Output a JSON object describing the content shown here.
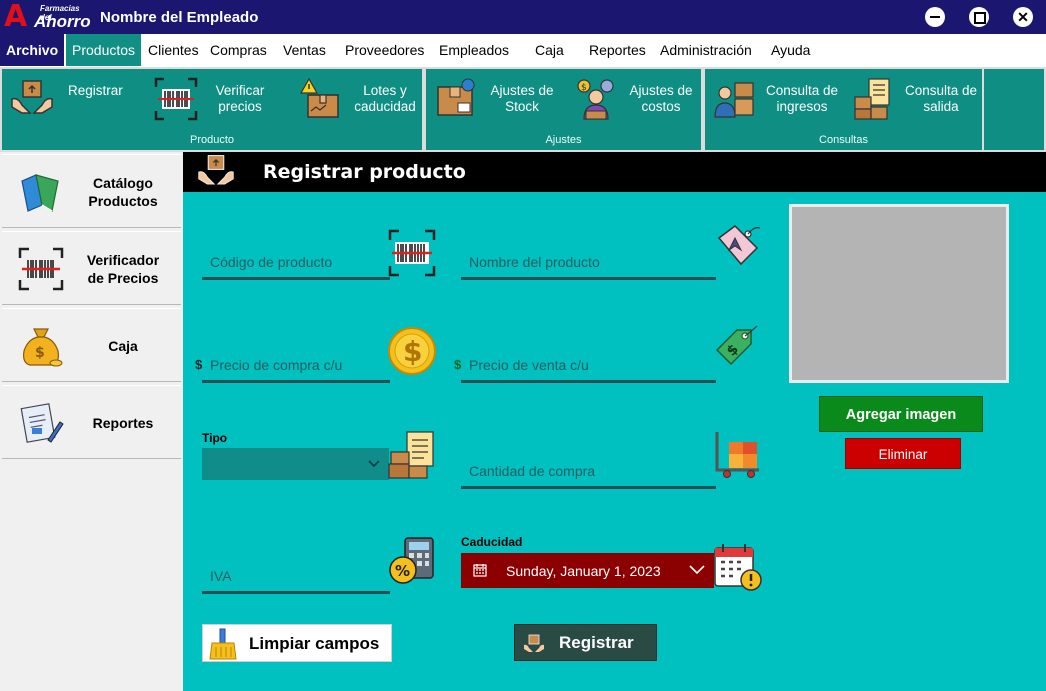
{
  "window": {
    "logo_small": "Farmacias del",
    "logo_big": "Ahorro",
    "title": "Nombre del Empleado"
  },
  "menu": {
    "items": [
      "Archivo",
      "Productos",
      "Clientes",
      "Compras",
      "Ventas",
      "Proveedores",
      "Empleados",
      "Caja",
      "Reportes",
      "Administración",
      "Ayuda"
    ],
    "active": "Productos"
  },
  "ribbon": {
    "groups": [
      {
        "label": "Producto",
        "buttons": [
          "Registrar",
          "Verificar precios",
          "Lotes y caducidad"
        ]
      },
      {
        "label": "Ajustes",
        "buttons": [
          "Ajustes de Stock",
          "Ajustes de costos"
        ]
      },
      {
        "label": "Consultas",
        "buttons": [
          "Consulta de ingresos",
          "Consulta de salida"
        ]
      }
    ],
    "registrar": "Registrar",
    "verificar_l1": "Verificar",
    "verificar_l2": "precios",
    "lotes_l1": "Lotes y",
    "lotes_l2": "caducidad",
    "group_producto": "Producto",
    "stock_l1": "Ajustes de",
    "stock_l2": "Stock",
    "costos_l1": "Ajustes de",
    "costos_l2": "costos",
    "group_ajustes": "Ajustes",
    "ingresos_l1": "Consulta de",
    "ingresos_l2": "ingresos",
    "salida_l1": "Consulta de",
    "salida_l2": "salida",
    "group_consultas": "Consultas"
  },
  "sidebar": {
    "catalogo_l1": "Catálogo",
    "catalogo_l2": "Productos",
    "verificador_l1": "Verificador",
    "verificador_l2": "de Precios",
    "caja": "Caja",
    "reportes": "Reportes"
  },
  "form": {
    "header": "Registrar producto",
    "codigo_placeholder": "Código de producto",
    "nombre_placeholder": "Nombre del producto",
    "currency_symbol": "$",
    "precio_compra_placeholder": "Precio de compra c/u",
    "precio_venta_placeholder": "Precio de venta c/u",
    "tipo_label": "Tipo",
    "tipo_value": "",
    "cantidad_placeholder": "Cantidad de compra",
    "iva_placeholder": "IVA",
    "caducidad_label": "Caducidad",
    "caducidad_value": "Sunday, January 1, 2023",
    "add_image": "Agregar imagen",
    "delete_image": "Eliminar",
    "clear_button": "Limpiar campos",
    "register_button": "Registrar"
  },
  "colors": {
    "titlebar": "#1b1670",
    "ribbon": "#0f8f83",
    "main_bg": "#00c0c0",
    "date_picker": "#8b0000",
    "add_image": "#0b8a1c",
    "delete": "#cc0000"
  }
}
